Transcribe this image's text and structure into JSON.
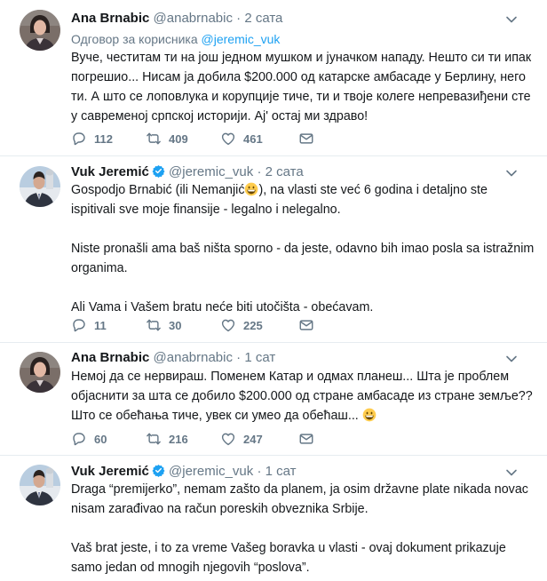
{
  "tweets": [
    {
      "name": "Ana Brnabic",
      "handle": "@anabrnabic",
      "dot": "·",
      "time": "2 сата",
      "reply_prefix": "Одговор за корисника ",
      "reply_mention": "@jeremic_vuk",
      "paragraphs": [
        "Вуче, честитам ти на још једном мушком и јуначком нападу. Нешто си ти ипак погрешио... Нисам ја добила $200.000 од катарске амбасаде у Берлину, него ти. А што се лоповлука и корупције тиче, ти и твоје колеге непревазиђени сте у савременој српској историји. Ај' остај ми здраво!"
      ],
      "replies": "112",
      "retweets": "409",
      "likes": "461"
    },
    {
      "name": "Vuk Jeremić",
      "handle": "@jeremic_vuk",
      "dot": "·",
      "time": "2 сата",
      "paragraphs": [
        "Gospodjo Brnabić (ili Nemanjić",
        "), na vlasti ste već 6 godina i detaljno ste ispitivali sve moje finansije - legalno i nelegalno.",
        "Niste pronašli ama baš ništa sporno - da jeste, odavno bih imao posla sa istražnim organima.",
        "Ali Vama i Vašem bratu neće biti utočišta - obećavam."
      ],
      "replies": "11",
      "retweets": "30",
      "likes": "225"
    },
    {
      "name": "Ana Brnabic",
      "handle": "@anabrnabic",
      "dot": "·",
      "time": "1 сат",
      "paragraphs": [
        "Немој да се нервираш. Поменем Катар и одмах планеш... Шта је проблем објаснити за шта се добило $200.000 од стране амбасаде из стране земље?? Што се обећања тиче, увек си умео да обећаш..."
      ],
      "replies": "60",
      "retweets": "216",
      "likes": "247"
    },
    {
      "name": "Vuk Jeremić",
      "handle": "@jeremic_vuk",
      "dot": "·",
      "time": "1 сат",
      "paragraphs": [
        "Draga “premijerko”, nemam zašto da planem, ja osim državne plate nikada novac nisam zarađivao na račun poreskih obveznika Srbije.",
        "Vaš brat jeste, i to za vreme Vašeg boravka u vlasti - ovaj dokument prikazuje samo jedan od mnogih njegovih “poslova”."
      ]
    }
  ],
  "colors": {
    "text": "#14171a",
    "secondary": "#657786",
    "link": "#1da1f2",
    "verified": "#1da1f2",
    "divider": "#e6ecf0"
  },
  "icons": [
    "reply-icon",
    "retweet-icon",
    "like-icon",
    "direct-message-icon",
    "caret-down-icon",
    "verified-badge-icon",
    "grinning-emoji-icon"
  ]
}
